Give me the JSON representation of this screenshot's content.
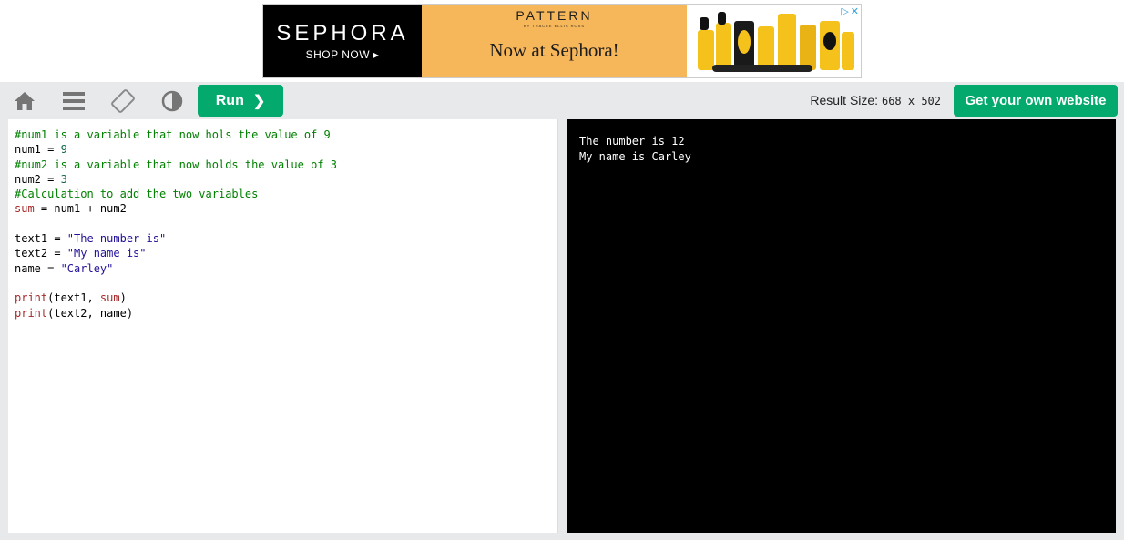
{
  "ad": {
    "brand": "SEPHORA",
    "shop_now": "SHOP NOW ▸",
    "product_brand": "PATTERN",
    "product_brand_sub": "BY TRACEE ELLIS ROSS",
    "tagline": "Now at Sephora!",
    "choices": [
      "▷",
      "✕"
    ]
  },
  "toolbar": {
    "home_icon": "home-icon",
    "menu_icon": "menu-icon",
    "rotate_icon": "rotate-icon",
    "theme_icon": "contrast-icon",
    "run_label": "Run",
    "run_chevron": "❯",
    "result_size_label": "Result Size:",
    "result_size_value": "668 x 502",
    "get_website_label": "Get your own website"
  },
  "editor": {
    "lines": [
      [
        {
          "t": "#num1 is a variable that now hols the value of 9",
          "c": "comment"
        }
      ],
      [
        {
          "t": "num1 = ",
          "c": ""
        },
        {
          "t": "9",
          "c": "num"
        }
      ],
      [
        {
          "t": "#num2 is a variable that now holds the value of 3",
          "c": "comment"
        }
      ],
      [
        {
          "t": "num2 = ",
          "c": ""
        },
        {
          "t": "3",
          "c": "num"
        }
      ],
      [
        {
          "t": "#Calculation to add the two variables",
          "c": "comment"
        }
      ],
      [
        {
          "t": "sum",
          "c": "kw"
        },
        {
          "t": " = num1 + num2",
          "c": ""
        }
      ],
      [
        {
          "t": "",
          "c": ""
        }
      ],
      [
        {
          "t": "text1 = ",
          "c": ""
        },
        {
          "t": "\"The number is\"",
          "c": "str"
        }
      ],
      [
        {
          "t": "text2 = ",
          "c": ""
        },
        {
          "t": "\"My name is\"",
          "c": "str"
        }
      ],
      [
        {
          "t": "name = ",
          "c": ""
        },
        {
          "t": "\"Carley\"",
          "c": "str"
        }
      ],
      [
        {
          "t": "",
          "c": ""
        }
      ],
      [
        {
          "t": "print",
          "c": "kw"
        },
        {
          "t": "(text1, ",
          "c": ""
        },
        {
          "t": "sum",
          "c": "kw"
        },
        {
          "t": ")",
          "c": ""
        }
      ],
      [
        {
          "t": "print",
          "c": "kw"
        },
        {
          "t": "(text2, name)",
          "c": ""
        }
      ]
    ]
  },
  "output": {
    "lines": [
      "The number is 12",
      "My name is Carley"
    ]
  },
  "colors": {
    "accent_green": "#04aa6d",
    "toolbar_bg": "#e7e9eb",
    "output_bg": "#000000"
  }
}
